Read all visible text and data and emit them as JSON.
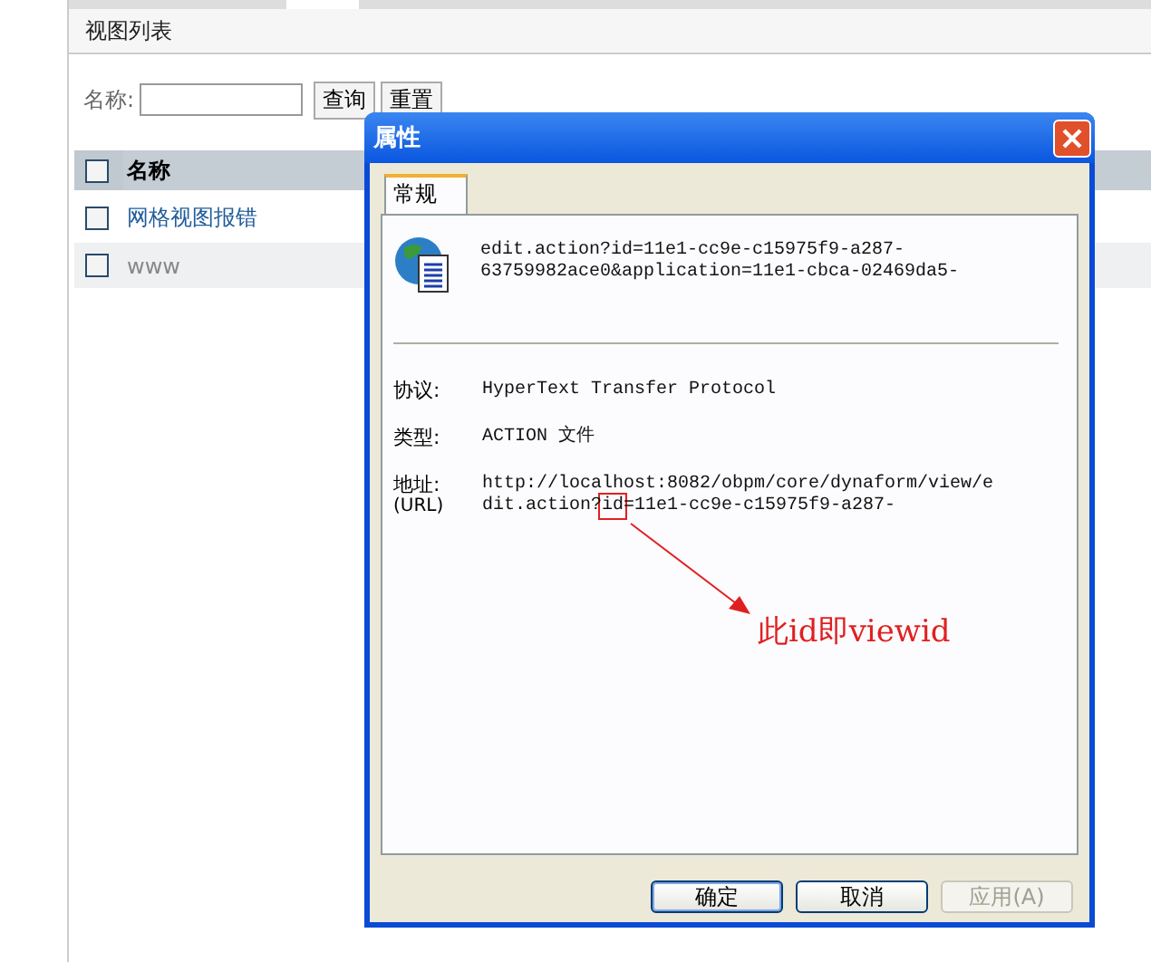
{
  "page": {
    "title": "视图列表",
    "search": {
      "label": "名称:"
    },
    "buttons": [
      "查询",
      "重置"
    ],
    "table": {
      "columns": [
        {
          "label": "名称",
          "checked": false
        }
      ],
      "rows": [
        {
          "name": "网格视图报错",
          "kind": "link",
          "checked": false
        },
        {
          "name": "www",
          "kind": "plain",
          "checked": false
        }
      ]
    }
  },
  "dialog": {
    "title": "属性",
    "tabs": [
      {
        "label": "常规",
        "selected": true
      }
    ],
    "file_name_lines": [
      "edit.action?id=11e1-cc9e-c15975f9-a287-",
      "63759982ace0&application=11e1-cbca-02469da5-"
    ],
    "properties": [
      {
        "label": "协议:",
        "kind": "text",
        "lines": [
          "HyperText Transfer Protocol"
        ]
      },
      {
        "label": "类型:",
        "kind": "text",
        "lines": [
          "ACTION 文件"
        ]
      },
      {
        "label": "地址:",
        "sublabel": "(URL)",
        "kind": "address",
        "lines": [
          "http://localhost:8082/obpm/core/dynaform/view/e",
          "dit.action?id=11e1-cc9e-c15975f9-a287-"
        ]
      }
    ],
    "buttons": [
      {
        "label": "确定",
        "default": true,
        "disabled": false
      },
      {
        "label": "取消",
        "default": false,
        "disabled": false
      },
      {
        "label": "应用(A)",
        "default": false,
        "disabled": true
      }
    ]
  },
  "annotation": {
    "text": "此id即viewid"
  }
}
